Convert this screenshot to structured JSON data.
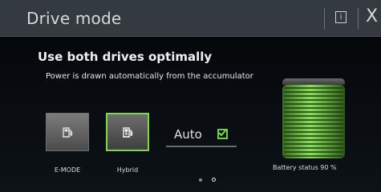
{
  "header": {
    "title": "Drive mode",
    "info_icon": "info-icon",
    "close_icon": "close-icon",
    "info_glyph": "i",
    "close_glyph": "X"
  },
  "main": {
    "headline": "Use both drives optimally",
    "description": "Power is drawn automatically from the accumulator"
  },
  "modes": [
    {
      "label": "E-MODE",
      "icon": "fuel-pump-icon",
      "selected": false
    },
    {
      "label": "Hybrid",
      "icon": "fuel-pump-plug-icon",
      "selected": true
    }
  ],
  "auto": {
    "label": "Auto",
    "checked": true
  },
  "pagination": {
    "pages": 2,
    "current": 2
  },
  "battery": {
    "label": "Battery status",
    "percent_text": "90 %",
    "level": 0.9
  },
  "colors": {
    "accent": "#7ad94a",
    "header_bg": "#333a40"
  }
}
